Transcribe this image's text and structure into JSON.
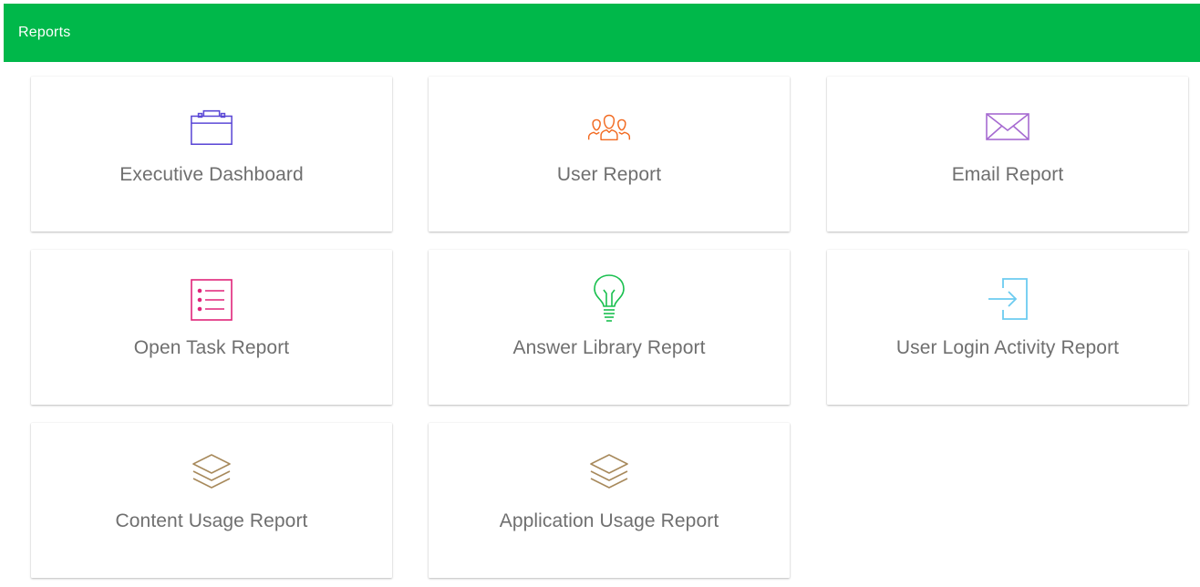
{
  "header": {
    "title": "Reports",
    "color": "#00b84a"
  },
  "cards": [
    {
      "label": "Executive Dashboard",
      "icon": "briefcase-icon",
      "icon_color": "#5b48d6"
    },
    {
      "label": "User Report",
      "icon": "users-group-icon",
      "icon_color": "#f26a21"
    },
    {
      "label": "Email Report",
      "icon": "envelope-icon",
      "icon_color": "#a66ad1"
    },
    {
      "label": "Open Task Report",
      "icon": "list-icon",
      "icon_color": "#e0247a"
    },
    {
      "label": "Answer Library Report",
      "icon": "lightbulb-icon",
      "icon_color": "#19c04f"
    },
    {
      "label": "User Login Activity Report",
      "icon": "login-arrow-icon",
      "icon_color": "#6ccbf0"
    },
    {
      "label": "Content Usage Report",
      "icon": "layers-icon",
      "icon_color": "#a88a5c"
    },
    {
      "label": "Application Usage Report",
      "icon": "layers-icon",
      "icon_color": "#a88a5c"
    }
  ]
}
